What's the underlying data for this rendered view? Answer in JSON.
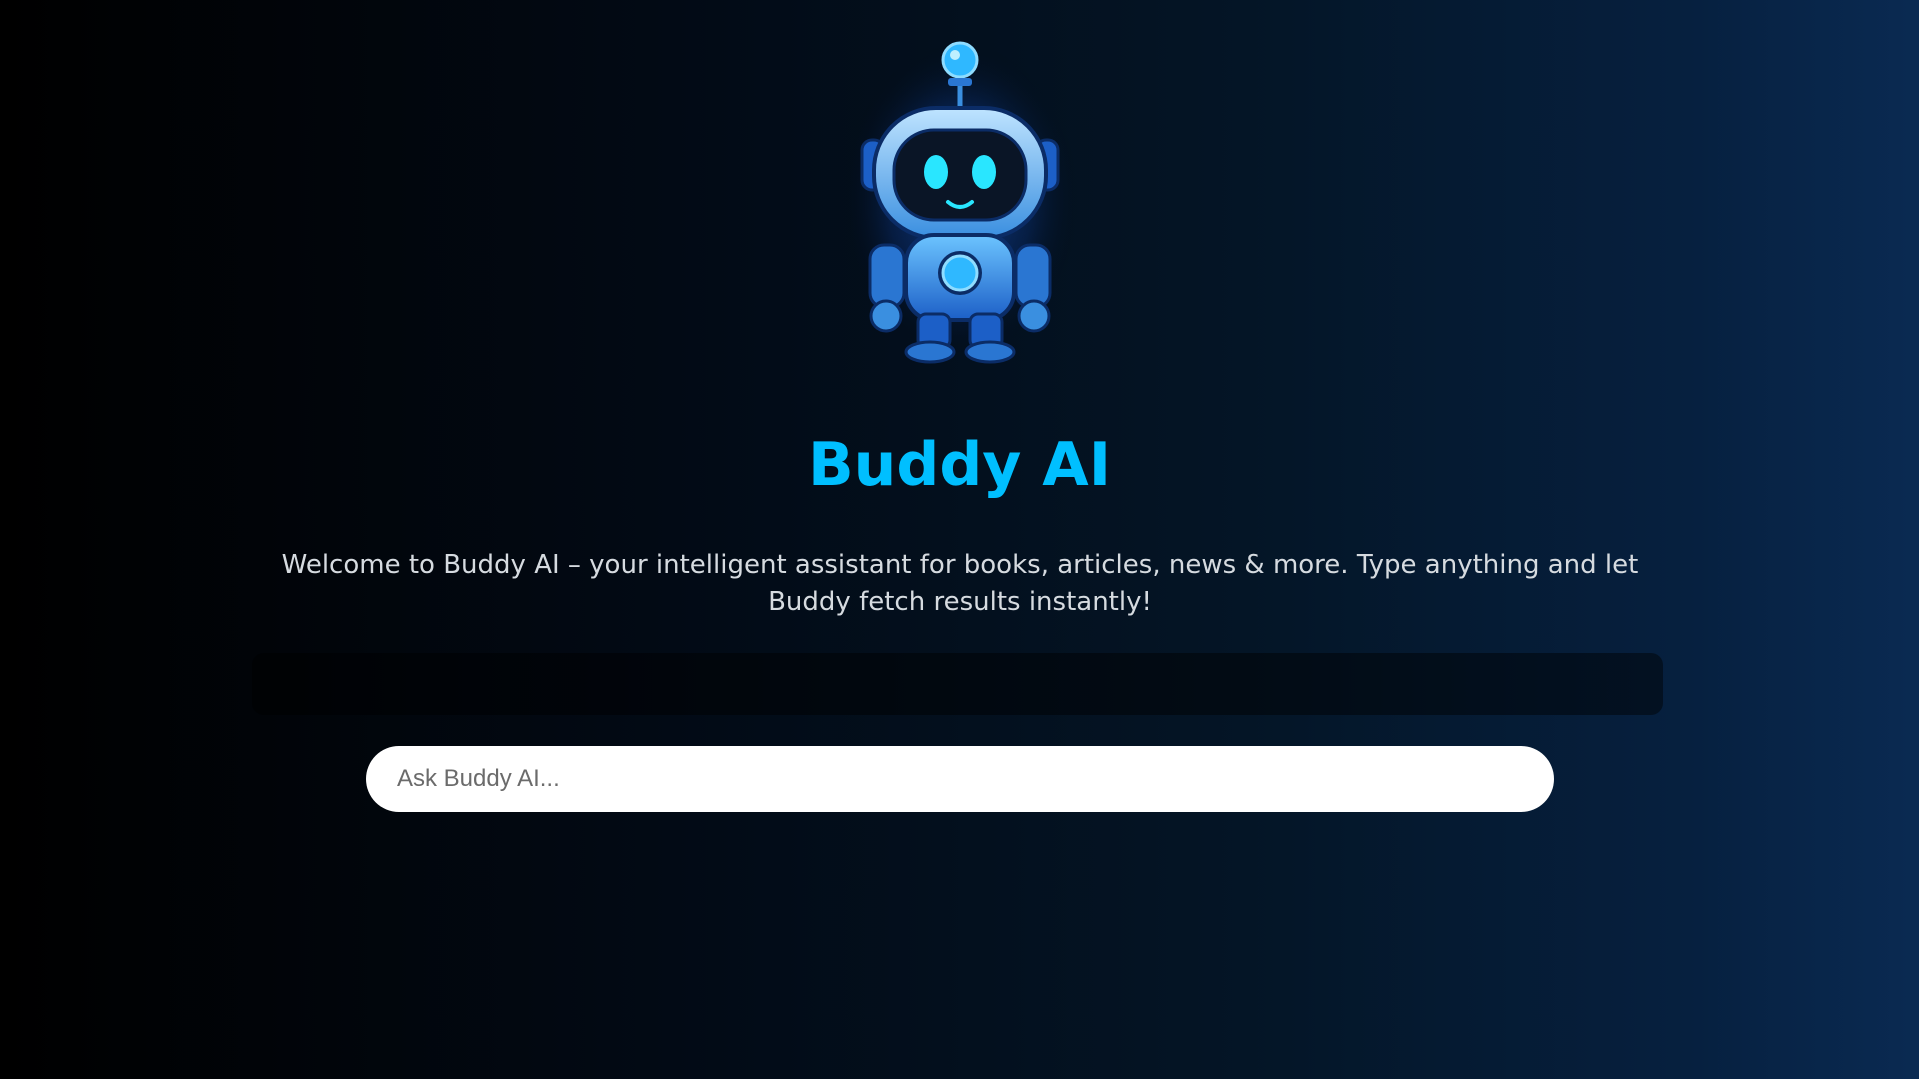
{
  "hero": {
    "mascot_icon": "robot-mascot-icon",
    "title": "Buddy AI",
    "subtitle": "Welcome to Buddy AI – your intelligent assistant for books, articles, news & more. Type anything and let Buddy fetch results instantly!"
  },
  "search": {
    "value": "",
    "placeholder": "Ask Buddy AI..."
  },
  "colors": {
    "accent": "#00bfff",
    "robot_body": "#3aa9f5",
    "robot_glow": "#1e6bff",
    "text": "#d6dbe0"
  }
}
